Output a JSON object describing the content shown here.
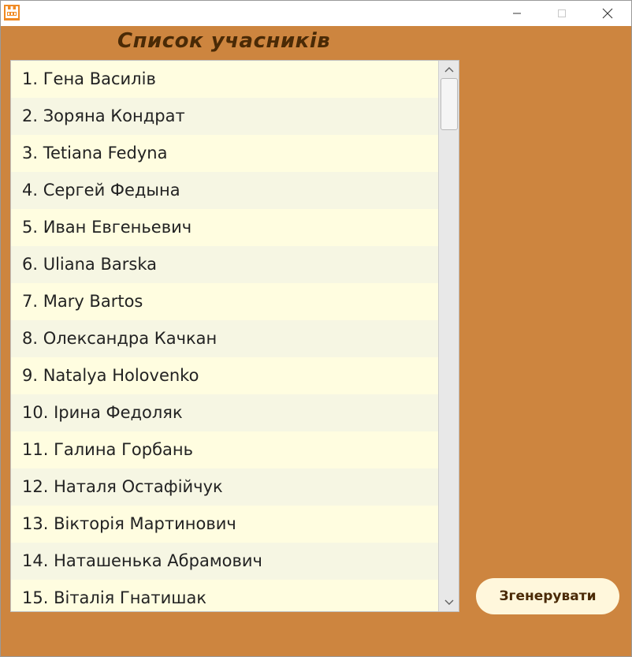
{
  "window": {
    "app_icon": "castle-app-icon",
    "controls": {
      "minimize": "minimize-icon",
      "maximize": "maximize-icon",
      "close": "close-icon"
    }
  },
  "main": {
    "list_title": "Список учасників",
    "participants": [
      "1. Гена Василів",
      "2. Зоряна Кондрат",
      "3. Tetiana Fedyna",
      "4. Сергей Федына",
      "5. Иван Евгеньевич",
      "6. Uliana Barska",
      "7. Mary Bartos",
      "8. Олександра Качкан",
      "9. Natalya Holovenko",
      "10. Ірина Федоляк",
      "11. Галина Горбань",
      "12. Наталя Остафійчук",
      "13. Вікторія Мартинович",
      "14. Наташенька Абрамович",
      "15. Віталія Гнатишак"
    ],
    "generate_button_label": "Згенерувати"
  },
  "colors": {
    "window_background": "#cd853f",
    "list_background": "#fffde0",
    "list_row_alt": "#f6f6e3",
    "title_text": "#4a2a06",
    "button_background": "#fff7dc"
  }
}
